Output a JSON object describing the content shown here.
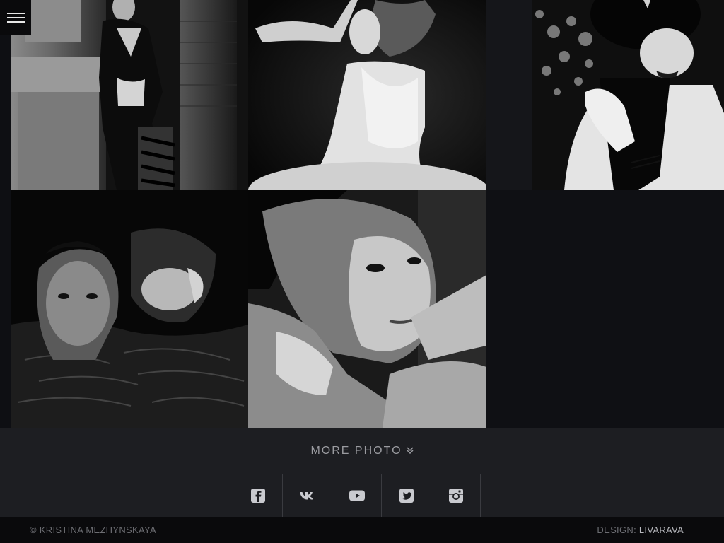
{
  "nav": {
    "menu_icon": "hamburger-menu-icon"
  },
  "gallery": {
    "photos": [
      {
        "name": "photo-woman-at-stone-column"
      },
      {
        "name": "photo-woman-in-white-gown"
      },
      {
        "name": "photo-woman-with-hat"
      },
      {
        "name": "photo-couple-in-water"
      },
      {
        "name": "photo-woman-portrait-wet"
      }
    ]
  },
  "more": {
    "label": "MORE PHOTO",
    "icon": "double-chevron-down-icon"
  },
  "social": {
    "items": [
      {
        "icon": "facebook-icon"
      },
      {
        "icon": "vk-icon"
      },
      {
        "icon": "youtube-icon"
      },
      {
        "icon": "twitter-icon"
      },
      {
        "icon": "instagram-icon"
      }
    ]
  },
  "footer": {
    "copyright": "© KRISTINA MEZHYNSKAYA",
    "design_label": "DESIGN:",
    "design_link": "LIVARAVA"
  },
  "colors": {
    "background": "#1d1e22",
    "footer_bg": "#0a0a0c",
    "icon": "#c9cacf",
    "text_muted": "#9a9ba0"
  }
}
